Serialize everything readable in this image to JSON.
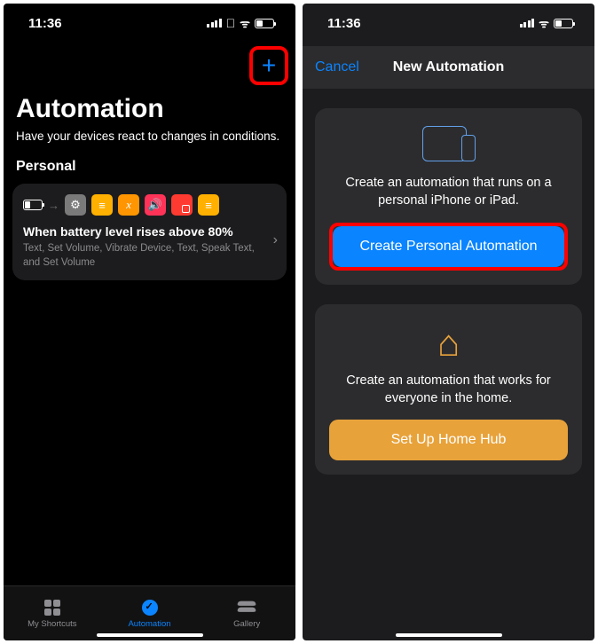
{
  "status": {
    "time": "11:36"
  },
  "left": {
    "title": "Automation",
    "subtitle": "Have your devices react to changes in conditions.",
    "section": "Personal",
    "card": {
      "title": "When battery level rises above 80%",
      "desc": "Text, Set Volume, Vibrate Device, Text, Speak Text, and Set Volume"
    },
    "tabs": {
      "shortcuts": "My Shortcuts",
      "automation": "Automation",
      "gallery": "Gallery"
    }
  },
  "right": {
    "cancel": "Cancel",
    "title": "New Automation",
    "personal": {
      "text": "Create an automation that runs on a personal iPhone or iPad.",
      "button": "Create Personal Automation"
    },
    "home": {
      "text": "Create an automation that works for everyone in the home.",
      "button": "Set Up Home Hub"
    }
  }
}
